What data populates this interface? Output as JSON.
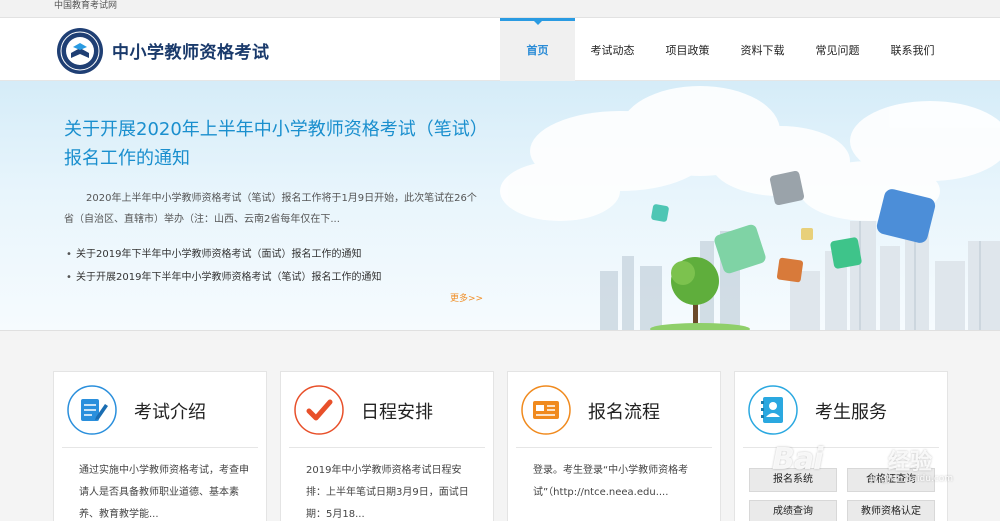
{
  "topbar": {
    "site_name": "中国教育考试网"
  },
  "header": {
    "brand": "中小学教师资格考试",
    "nav": [
      {
        "label": "首页",
        "active": true
      },
      {
        "label": "考试动态",
        "active": false
      },
      {
        "label": "项目政策",
        "active": false
      },
      {
        "label": "资料下载",
        "active": false
      },
      {
        "label": "常见问题",
        "active": false
      },
      {
        "label": "联系我们",
        "active": false
      }
    ]
  },
  "banner": {
    "title": "关于开展2020年上半年中小学教师资格考试（笔试）报名工作的通知",
    "summary": "2020年上半年中小学教师资格考试（笔试）报名工作将于1月9日开始，此次笔试在26个省（自治区、直辖市）举办（注：山西、云南2省每年仅在下...",
    "links": [
      "关于2019年下半年中小学教师资格考试（面试）报名工作的通知",
      "关于开展2019年下半年中小学教师资格考试（笔试）报名工作的通知"
    ],
    "more": "更多>>"
  },
  "cards": [
    {
      "title": "考试介绍",
      "icon": "notepad-pen-icon",
      "color": "#2a8fdc",
      "body": "通过实施中小学教师资格考试，考查申请人是否具备教师职业道德、基本素养、教育教学能..."
    },
    {
      "title": "日程安排",
      "icon": "checkmark-icon",
      "color": "#e8502a",
      "body": "2019年中小学教师资格考试日程安排：上半年笔试日期3月9日，面试日期：5月18..."
    },
    {
      "title": "报名流程",
      "icon": "registration-form-icon",
      "color": "#f08a1e",
      "body": "登录。考生登录“中小学教师资格考试”（http://ntce.neea.edu...."
    },
    {
      "title": "考生服务",
      "icon": "address-book-icon",
      "color": "#2aa8e0",
      "services": [
        "报名系统",
        "合格证查询",
        "成绩查询",
        "教师资格认定"
      ]
    }
  ],
  "watermark": {
    "text": "Bai",
    "cn": "经验",
    "url": "jingyan.baidu.com"
  },
  "colors": {
    "accent_blue": "#2a9be2",
    "title_blue": "#1a8fce",
    "brand_navy": "#1a3a6b",
    "more_orange": "#f0902a"
  }
}
